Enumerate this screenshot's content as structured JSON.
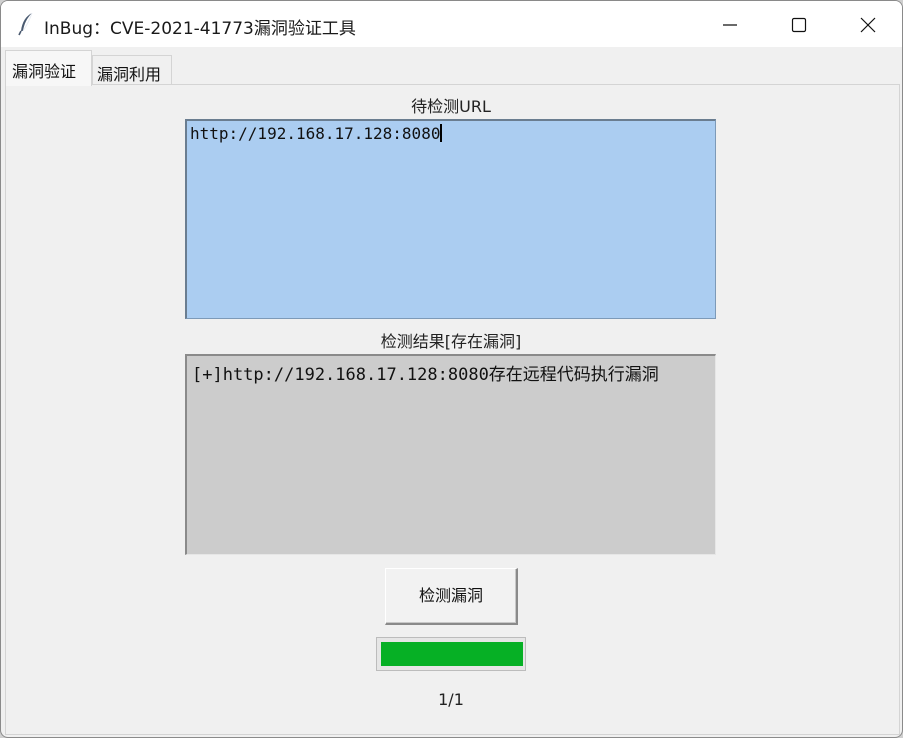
{
  "window": {
    "title": "InBug：CVE-2021-41773漏洞验证工具",
    "icon": "feather-icon"
  },
  "controls": {
    "minimize_icon": "minimize-icon",
    "maximize_icon": "maximize-icon",
    "close_icon": "close-icon"
  },
  "tabs": [
    {
      "label": "漏洞验证",
      "active": true
    },
    {
      "label": "漏洞利用",
      "active": false
    }
  ],
  "main": {
    "url_label": "待检测URL",
    "url_value": "http://192.168.17.128:8080",
    "result_label": "检测结果[存在漏洞]",
    "result_text": "[+]http://192.168.17.128:8080存在远程代码执行漏洞",
    "check_button_label": "检测漏洞",
    "progress_fraction": 1.0,
    "count_label": "1/1"
  },
  "colors": {
    "url_box_bg": "#abcdf1",
    "result_box_bg": "#cccccc",
    "progress_fill": "#06b025"
  }
}
